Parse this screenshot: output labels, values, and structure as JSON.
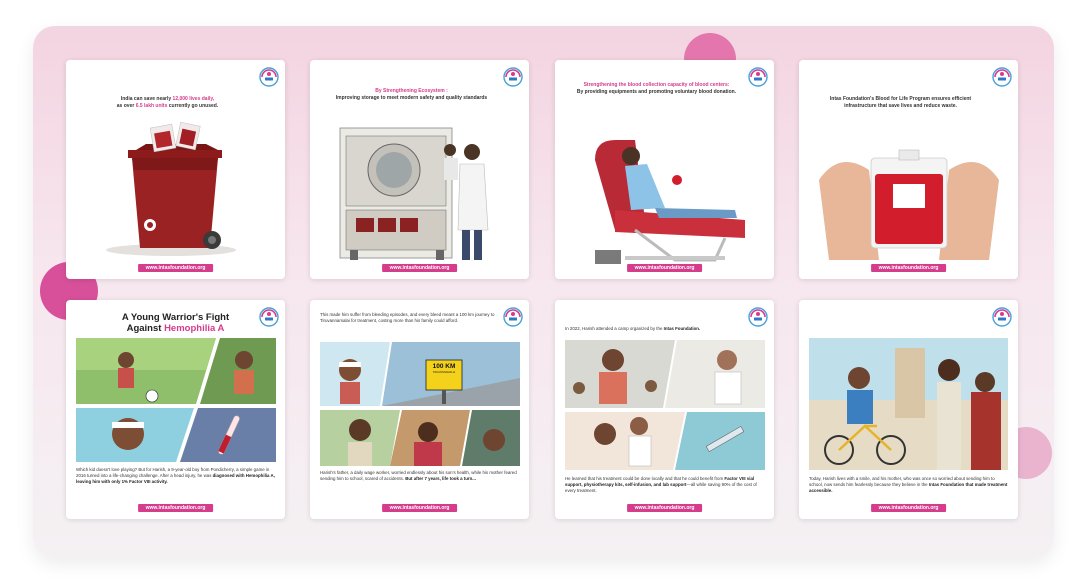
{
  "url_label": "www.intasfoundation.org",
  "colors": {
    "accent": "#d53c8c",
    "background": "#f3d4e1"
  },
  "cards": [
    {
      "caption_main": "India can save nearly",
      "caption_highlight": "12,000 lives daily,",
      "caption_line2_a": "as over",
      "caption_line2_highlight": "6.5 lakh units",
      "caption_line2_b": "currently go unused."
    },
    {
      "caption_title": "By Strengthening Ecosystem :",
      "caption_body": "Improving storage to meet modern safety and quality standards"
    },
    {
      "caption_title": "Strengthening the blood collection capacity of blood centers:",
      "caption_body": "By providing equipments and promoting voluntary blood donation."
    },
    {
      "caption_body": "Intas Foundation's Blood for Life Program ensures efficient infrastructure that save lives and reduce waste."
    },
    {
      "title_a": "A Young Warrior's Fight",
      "title_b": "Against",
      "title_highlight": "Hemophilia A",
      "body_a": "Which kid doesn't love playing? But for Harish, a 9-year-old boy from Pondicherry, a simple game in 2016 turned into a life-changing challenge. After a head injury, he was",
      "body_bold": "diagnosed with Hemophilia A, leaving him with only 1% Factor VIII activity."
    },
    {
      "body_top": "This made him suffer from bleeding episodes, and every bleed meant a 100 km journey to Tiruvannamalai for treatment, costing more than his family could afford.",
      "sign_big": "100 KM",
      "sign_small": "TIRUVANNAMALAI",
      "body_a": "Harish's father, a daily wage worker, worried endlessly about his son's health, while his mother feared sending him to school, scared of accidents.",
      "body_bold": "But after 7 years, life took a turn..."
    },
    {
      "body_top_a": "In 2022, Harish attended a camp organized by the",
      "body_top_bold": "Intas Foundation.",
      "body_a": "He learned that his treatment could be done locally and that he could benefit from",
      "body_bold": "Factor VIII vial support, physiotherapy kits, self-infusion, and lab support",
      "body_b": "—all while saving 90% of the cost of every treatment."
    },
    {
      "body_a": "Today, Harish lives with a smile, and his mother, who was once so worried about sending him to school, now sends him fearlessly because they believe in the",
      "body_bold": "Intas Foundation that made treatment accessible."
    }
  ]
}
